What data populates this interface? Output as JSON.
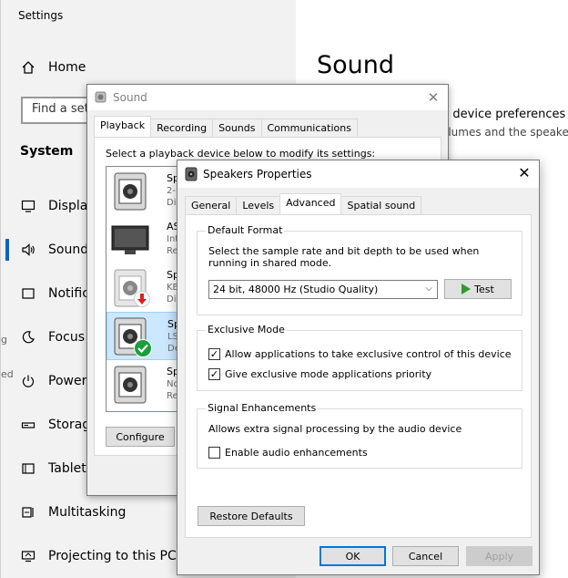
{
  "settings": {
    "title": "Settings",
    "home": "Home",
    "search_placeholder": "Find a setting",
    "section": "System",
    "nav": [
      {
        "label": "Display",
        "icon": "display-icon"
      },
      {
        "label": "Sound",
        "icon": "sound-icon"
      },
      {
        "label": "Notifications & actions",
        "icon": "notifications-icon"
      },
      {
        "label": "Focus assist",
        "icon": "focus-assist-icon"
      },
      {
        "label": "Power & sleep",
        "icon": "power-icon"
      },
      {
        "label": "Storage",
        "icon": "storage-icon"
      },
      {
        "label": "Tablet",
        "icon": "tablet-icon"
      },
      {
        "label": "Multitasking",
        "icon": "multitasking-icon"
      },
      {
        "label": "Projecting to this PC",
        "icon": "projecting-icon"
      }
    ],
    "page_title": "Sound",
    "partial_line1": "d device preferences",
    "partial_line2": "olumes and the speake",
    "left_edge_1": "g",
    "left_edge_2": "ed"
  },
  "sound_dialog": {
    "title": "Sound",
    "tabs": [
      "Playback",
      "Recording",
      "Sounds",
      "Communications"
    ],
    "instruction": "Select a playback device below to modify its settings:",
    "devices": [
      {
        "name": "Sp",
        "sub1": "2-",
        "sub2": "Di"
      },
      {
        "name": "AS",
        "sub1": "Int",
        "sub2": "Re"
      },
      {
        "name": "Sp",
        "sub1": "KE",
        "sub2": "Dis"
      },
      {
        "name": "Sp",
        "sub1": "LS",
        "sub2": "De"
      },
      {
        "name": "Sp",
        "sub1": "No",
        "sub2": "Re"
      }
    ],
    "configure": "Configure"
  },
  "props_dialog": {
    "title": "Speakers Properties",
    "tabs": [
      "General",
      "Levels",
      "Advanced",
      "Spatial sound"
    ],
    "default_format": {
      "label": "Default Format",
      "description": "Select the sample rate and bit depth to be used when running in shared mode.",
      "selected": "24 bit, 48000 Hz (Studio Quality)",
      "test": "Test"
    },
    "exclusive_mode": {
      "label": "Exclusive Mode",
      "allow_exclusive": "Allow applications to take exclusive control of this device",
      "allow_exclusive_checked": true,
      "priority": "Give exclusive mode applications priority",
      "priority_checked": true
    },
    "signal_enhancements": {
      "label": "Signal Enhancements",
      "description": "Allows extra signal processing by the audio device",
      "enable": "Enable audio enhancements",
      "enable_checked": false
    },
    "restore_defaults": "Restore Defaults",
    "ok": "OK",
    "cancel": "Cancel",
    "apply": "Apply"
  },
  "colors": {
    "accent": "#0067c0",
    "selection": "#cce8ff",
    "test_arrow": "#2e9c2e",
    "default_check": "#1a9e3c",
    "down_arrow": "#e02020"
  }
}
